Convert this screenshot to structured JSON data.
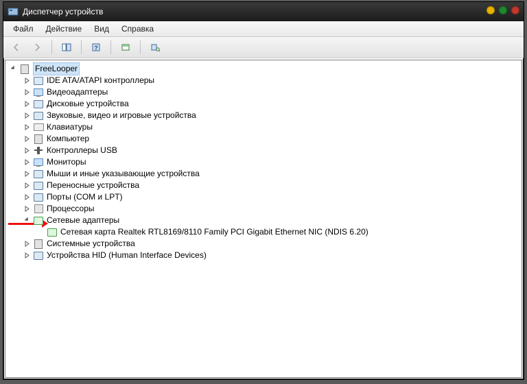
{
  "titlebar": {
    "title": "Диспетчер устройств"
  },
  "menubar": {
    "file": "Файл",
    "action": "Действие",
    "view": "Вид",
    "help": "Справка"
  },
  "tree": {
    "root": "FreeLooper",
    "items": [
      {
        "label": "IDE ATA/ATAPI контроллеры",
        "expandable": true,
        "expanded": false
      },
      {
        "label": "Видеоадаптеры",
        "expandable": true,
        "expanded": false
      },
      {
        "label": "Дисковые устройства",
        "expandable": true,
        "expanded": false
      },
      {
        "label": "Звуковые, видео и игровые устройства",
        "expandable": true,
        "expanded": false
      },
      {
        "label": "Клавиатуры",
        "expandable": true,
        "expanded": false
      },
      {
        "label": "Компьютер",
        "expandable": true,
        "expanded": false
      },
      {
        "label": "Контроллеры USB",
        "expandable": true,
        "expanded": false
      },
      {
        "label": "Мониторы",
        "expandable": true,
        "expanded": false
      },
      {
        "label": "Мыши и иные указывающие устройства",
        "expandable": true,
        "expanded": false
      },
      {
        "label": "Переносные устройства",
        "expandable": true,
        "expanded": false
      },
      {
        "label": "Порты (COM и LPT)",
        "expandable": true,
        "expanded": false
      },
      {
        "label": "Процессоры",
        "expandable": true,
        "expanded": false
      },
      {
        "label": "Сетевые адаптеры",
        "expandable": true,
        "expanded": true,
        "children": [
          {
            "label": "Сетевая карта Realtek RTL8169/8110 Family PCI Gigabit Ethernet NIC (NDIS 6.20)"
          }
        ]
      },
      {
        "label": "Системные устройства",
        "expandable": true,
        "expanded": false
      },
      {
        "label": "Устройства HID (Human Interface Devices)",
        "expandable": true,
        "expanded": false
      }
    ]
  }
}
